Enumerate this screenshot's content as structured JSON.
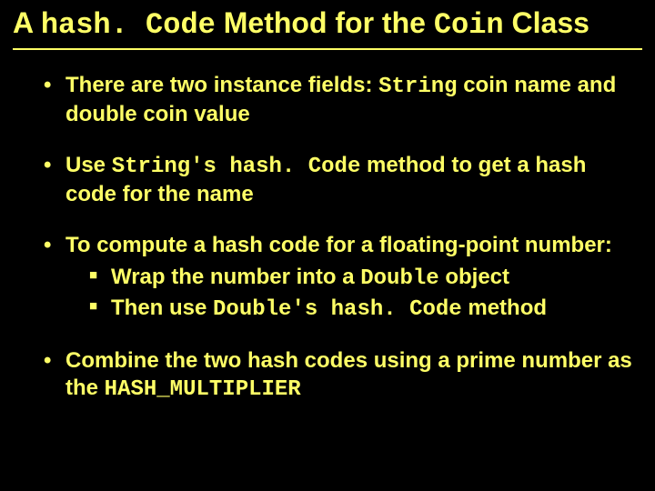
{
  "title": {
    "pre": "A ",
    "code1": "hash. Code",
    "mid": " Method for the ",
    "code2": "Coin",
    "post": " Class"
  },
  "b1": {
    "pre": "There are two instance fields: ",
    "code": "String",
    "post": " coin name and double coin value"
  },
  "b2": {
    "pre": "Use ",
    "code": "String's hash. Code",
    "post": " method to get a hash code for the name"
  },
  "b3": {
    "lead": "To compute a hash code for a floating-point number:",
    "s1": {
      "pre": "Wrap the number into a ",
      "code": "Double",
      "post": " object"
    },
    "s2": {
      "pre": "Then use ",
      "code": "Double's hash. Code",
      "post": " method"
    }
  },
  "b4": {
    "pre": "Combine the two hash codes using a prime number as the ",
    "code": "HASH_MULTIPLIER"
  }
}
